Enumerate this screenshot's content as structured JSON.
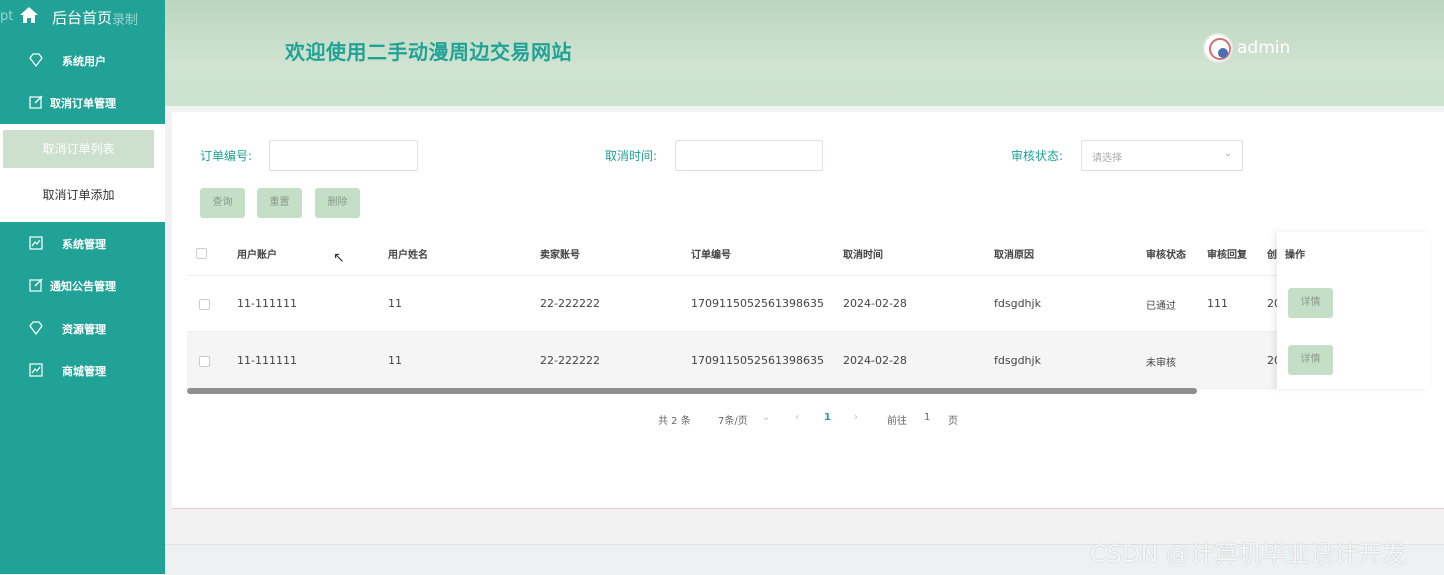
{
  "sidebar": {
    "home_ghost": "pt",
    "home_ghost2": "录制",
    "home_label": "后台首页",
    "items": [
      {
        "label": "系统用户",
        "icon": "diamond-icon"
      },
      {
        "label": "取消订单管理",
        "icon": "edit-icon"
      },
      {
        "label": "系统管理",
        "icon": "chart-icon"
      },
      {
        "label": "通知公告管理",
        "icon": "edit-icon"
      },
      {
        "label": "资源管理",
        "icon": "diamond-icon"
      },
      {
        "label": "商城管理",
        "icon": "chart-icon"
      }
    ],
    "submenu": [
      {
        "label": "取消订单列表",
        "active": true
      },
      {
        "label": "取消订单添加",
        "active": false
      }
    ]
  },
  "header": {
    "title": "欢迎使用二手动漫周边交易网站",
    "username": "admin"
  },
  "filters": {
    "order_no_label": "订单编号:",
    "cancel_time_label": "取消时间:",
    "status_label": "审核状态:",
    "status_placeholder": "请选择"
  },
  "buttons": {
    "query": "查询",
    "reset": "重置",
    "delete": "删除"
  },
  "table": {
    "headers": [
      "用户账户",
      "用户姓名",
      "卖家账号",
      "订单编号",
      "取消时间",
      "取消原因",
      "审核状态",
      "审核回复",
      "创",
      "操作"
    ],
    "rows": [
      [
        "11-111111",
        "11",
        "22-222222",
        "1709115052561398635",
        "2024-02-28",
        "fdsgdhjk",
        "已通过",
        "111",
        "20"
      ],
      [
        "11-111111",
        "11",
        "22-222222",
        "1709115052561398635",
        "2024-02-28",
        "fdsgdhjk",
        "未审核",
        "",
        "20"
      ]
    ],
    "detail_label": "详情"
  },
  "pagination": {
    "total": "共 2 条",
    "page_size": "7条/页",
    "current_page": "1",
    "goto_label": "前往",
    "goto_value": "1",
    "page_suffix": "页"
  },
  "watermark": "CSDN @计算机毕业设计开发",
  "colors": {
    "sidebar": "#21a296",
    "header": "#cfe3d0",
    "button": "#c4dfc6"
  }
}
